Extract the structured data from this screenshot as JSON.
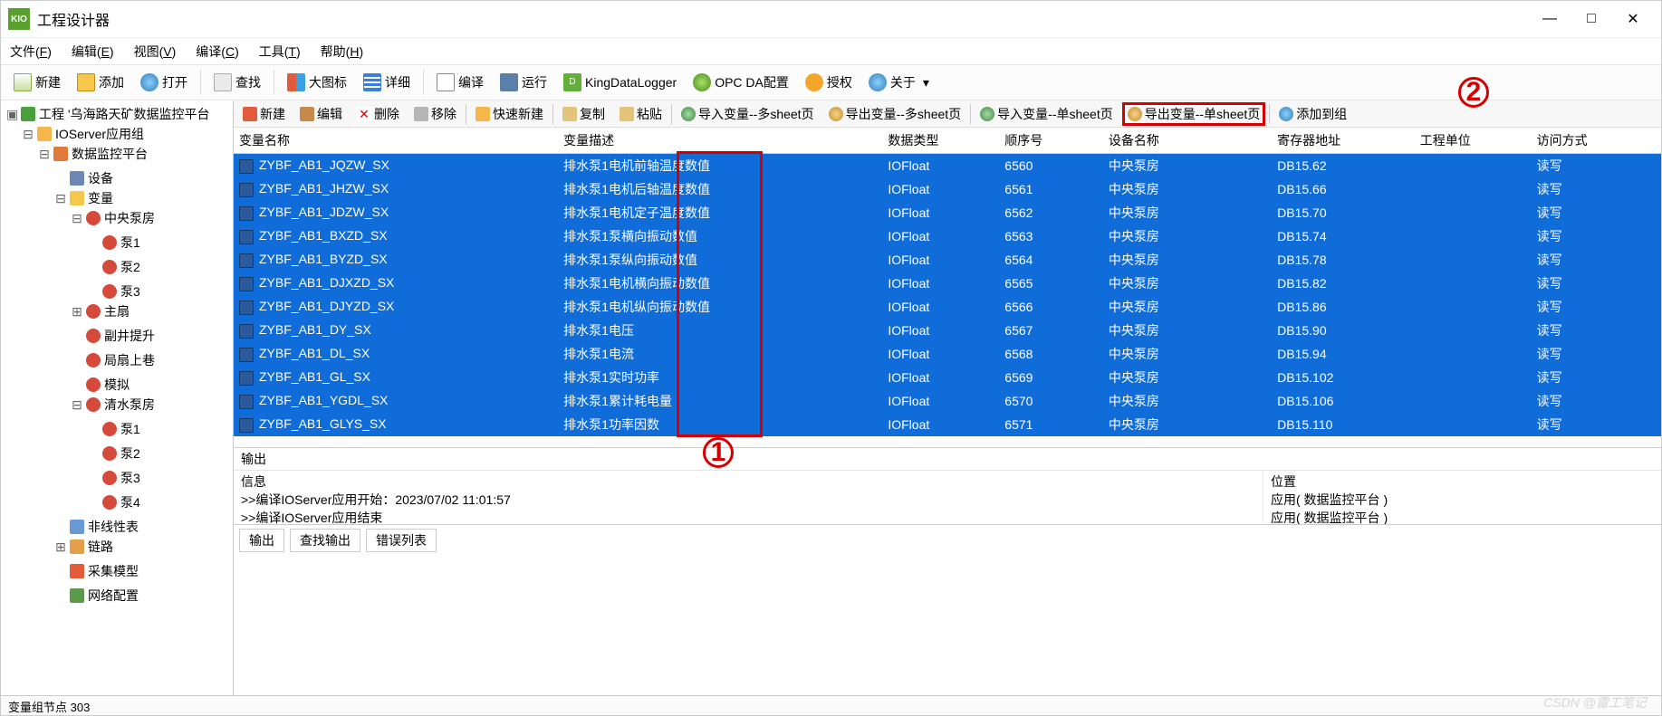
{
  "app": {
    "icon_label": "KIO",
    "title": "工程设计器"
  },
  "window_controls": {
    "minimize": "—",
    "maximize": "□",
    "close": "✕"
  },
  "menubar": [
    {
      "label": "文件",
      "key": "F"
    },
    {
      "label": "编辑",
      "key": "E"
    },
    {
      "label": "视图",
      "key": "V"
    },
    {
      "label": "编译",
      "key": "C"
    },
    {
      "label": "工具",
      "key": "T"
    },
    {
      "label": "帮助",
      "key": "H"
    }
  ],
  "main_toolbar": {
    "new": "新建",
    "add": "添加",
    "open": "打开",
    "find": "查找",
    "big_icon": "大图标",
    "detail": "详细",
    "compile": "编译",
    "run": "运行",
    "kdl": "KingDataLogger",
    "opc": "OPC DA配置",
    "auth": "授权",
    "about": "关于"
  },
  "tree": {
    "root": "工程 '乌海路天矿数据监控平台",
    "ioserver": "IOServer应用组",
    "platform": "数据监控平台",
    "device": "设备",
    "variables": "变量",
    "zhongyang": "中央泵房",
    "pump1": "泵1",
    "pump2": "泵2",
    "pump3": "泵3",
    "pump4": "泵4",
    "zhushan": "主扇",
    "fujing": "副井提升",
    "jushan": "局扇上巷",
    "moni": "模拟",
    "qingshui": "清水泵房",
    "nonlinear": "非线性表",
    "link": "链路",
    "collect": "采集模型",
    "netcfg": "网络配置"
  },
  "sub_toolbar": {
    "new": "新建",
    "edit": "编辑",
    "delete": "删除",
    "move": "移除",
    "quick_new": "快速新建",
    "copy": "复制",
    "paste": "粘贴",
    "import_multi": "导入变量--多sheet页",
    "export_multi": "导出变量--多sheet页",
    "import_single": "导入变量--单sheet页",
    "export_single": "导出变量--单sheet页",
    "add_to_group": "添加到组"
  },
  "columns": {
    "name": "变量名称",
    "desc": "变量描述",
    "dtype": "数据类型",
    "seq": "顺序号",
    "device": "设备名称",
    "reg": "寄存器地址",
    "unit": "工程单位",
    "access": "访问方式"
  },
  "rows": [
    {
      "name": "ZYBF_AB1_JQZW_SX",
      "desc": "排水泵1电机前轴温度数值",
      "dtype": "IOFloat",
      "seq": "6560",
      "device": "中央泵房",
      "reg": "DB15.62",
      "access": "读写"
    },
    {
      "name": "ZYBF_AB1_JHZW_SX",
      "desc": "排水泵1电机后轴温度数值",
      "dtype": "IOFloat",
      "seq": "6561",
      "device": "中央泵房",
      "reg": "DB15.66",
      "access": "读写"
    },
    {
      "name": "ZYBF_AB1_JDZW_SX",
      "desc": "排水泵1电机定子温度数值",
      "dtype": "IOFloat",
      "seq": "6562",
      "device": "中央泵房",
      "reg": "DB15.70",
      "access": "读写"
    },
    {
      "name": "ZYBF_AB1_BXZD_SX",
      "desc": "排水泵1泵横向振动数值",
      "dtype": "IOFloat",
      "seq": "6563",
      "device": "中央泵房",
      "reg": "DB15.74",
      "access": "读写"
    },
    {
      "name": "ZYBF_AB1_BYZD_SX",
      "desc": "排水泵1泵纵向振动数值",
      "dtype": "IOFloat",
      "seq": "6564",
      "device": "中央泵房",
      "reg": "DB15.78",
      "access": "读写"
    },
    {
      "name": "ZYBF_AB1_DJXZD_SX",
      "desc": "排水泵1电机横向振动数值",
      "dtype": "IOFloat",
      "seq": "6565",
      "device": "中央泵房",
      "reg": "DB15.82",
      "access": "读写"
    },
    {
      "name": "ZYBF_AB1_DJYZD_SX",
      "desc": "排水泵1电机纵向振动数值",
      "dtype": "IOFloat",
      "seq": "6566",
      "device": "中央泵房",
      "reg": "DB15.86",
      "access": "读写"
    },
    {
      "name": "ZYBF_AB1_DY_SX",
      "desc": "排水泵1电压",
      "dtype": "IOFloat",
      "seq": "6567",
      "device": "中央泵房",
      "reg": "DB15.90",
      "access": "读写"
    },
    {
      "name": "ZYBF_AB1_DL_SX",
      "desc": "排水泵1电流",
      "dtype": "IOFloat",
      "seq": "6568",
      "device": "中央泵房",
      "reg": "DB15.94",
      "access": "读写"
    },
    {
      "name": "ZYBF_AB1_GL_SX",
      "desc": "排水泵1实时功率",
      "dtype": "IOFloat",
      "seq": "6569",
      "device": "中央泵房",
      "reg": "DB15.102",
      "access": "读写"
    },
    {
      "name": "ZYBF_AB1_YGDL_SX",
      "desc": "排水泵1累计耗电量",
      "dtype": "IOFloat",
      "seq": "6570",
      "device": "中央泵房",
      "reg": "DB15.106",
      "access": "读写"
    },
    {
      "name": "ZYBF_AB1_GLYS_SX",
      "desc": "排水泵1功率因数",
      "dtype": "IOFloat",
      "seq": "6571",
      "device": "中央泵房",
      "reg": "DB15.110",
      "access": "读写"
    }
  ],
  "output": {
    "title": "输出",
    "info_header": "信息",
    "loc_header": "位置",
    "line1": ">>编译IOServer应用开始：2023/07/02 11:01:57",
    "line2": ">>编译IOServer应用结束",
    "loc1": "应用( 数据监控平台 )",
    "loc2": "应用( 数据监控平台 )",
    "tabs": {
      "out": "输出",
      "find": "查找输出",
      "err": "错误列表"
    }
  },
  "statusbar": "变量组节点   303",
  "watermark": "CSDN @雷工笔记",
  "annotations": {
    "one": "1",
    "two": "2"
  }
}
